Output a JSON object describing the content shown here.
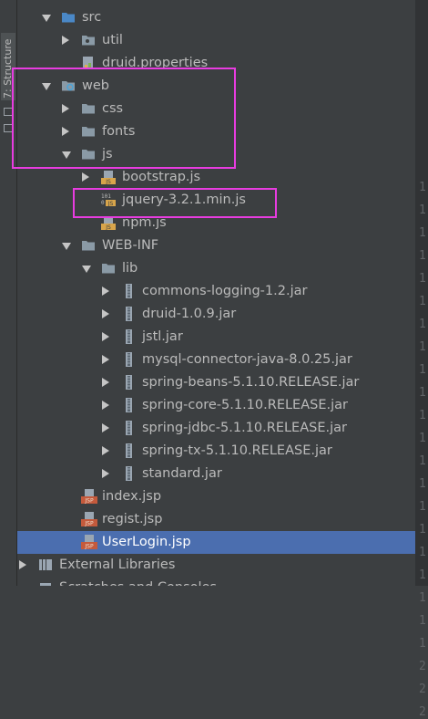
{
  "side_tab": {
    "label": "7: Structure"
  },
  "tree": [
    {
      "label": "src",
      "kind": "folder-src",
      "arrow": "down",
      "indent": 0
    },
    {
      "label": "util",
      "kind": "package",
      "arrow": "right",
      "indent": 1
    },
    {
      "label": "druid.properties",
      "kind": "properties",
      "arrow": "none",
      "indent": 1
    },
    {
      "label": "web",
      "kind": "folder-web",
      "arrow": "down",
      "indent": 0
    },
    {
      "label": "css",
      "kind": "folder",
      "arrow": "right",
      "indent": 1
    },
    {
      "label": "fonts",
      "kind": "folder",
      "arrow": "right",
      "indent": 1
    },
    {
      "label": "js",
      "kind": "folder",
      "arrow": "down",
      "indent": 1
    },
    {
      "label": "bootstrap.js",
      "kind": "js",
      "arrow": "right",
      "indent": 2
    },
    {
      "label": "jquery-3.2.1.min.js",
      "kind": "minjs",
      "arrow": "none",
      "indent": 2
    },
    {
      "label": "npm.js",
      "kind": "js",
      "arrow": "none",
      "indent": 2
    },
    {
      "label": "WEB-INF",
      "kind": "folder",
      "arrow": "down",
      "indent": 1
    },
    {
      "label": "lib",
      "kind": "folder",
      "arrow": "down",
      "indent": 2
    },
    {
      "label": "commons-logging-1.2.jar",
      "kind": "jar",
      "arrow": "right",
      "indent": 3
    },
    {
      "label": "druid-1.0.9.jar",
      "kind": "jar",
      "arrow": "right",
      "indent": 3
    },
    {
      "label": "jstl.jar",
      "kind": "jar",
      "arrow": "right",
      "indent": 3
    },
    {
      "label": "mysql-connector-java-8.0.25.jar",
      "kind": "jar",
      "arrow": "right",
      "indent": 3
    },
    {
      "label": "spring-beans-5.1.10.RELEASE.jar",
      "kind": "jar",
      "arrow": "right",
      "indent": 3
    },
    {
      "label": "spring-core-5.1.10.RELEASE.jar",
      "kind": "jar",
      "arrow": "right",
      "indent": 3
    },
    {
      "label": "spring-jdbc-5.1.10.RELEASE.jar",
      "kind": "jar",
      "arrow": "right",
      "indent": 3
    },
    {
      "label": "spring-tx-5.1.10.RELEASE.jar",
      "kind": "jar",
      "arrow": "right",
      "indent": 3
    },
    {
      "label": "standard.jar",
      "kind": "jar",
      "arrow": "right",
      "indent": 3
    },
    {
      "label": "index.jsp",
      "kind": "jsp",
      "arrow": "none",
      "indent": 1
    },
    {
      "label": "regist.jsp",
      "kind": "jsp",
      "arrow": "none",
      "indent": 1
    },
    {
      "label": "UserLogin.jsp",
      "kind": "jsp",
      "arrow": "none",
      "indent": 1,
      "selected": true
    },
    {
      "label": "External Libraries",
      "kind": "ext-lib",
      "arrow": "right",
      "indent": -1
    },
    {
      "label": "Scratches and Consoles",
      "kind": "scratches",
      "arrow": "none",
      "indent": -1
    }
  ],
  "gutter_numbers": [
    "1",
    "1",
    "1",
    "1",
    "1",
    "1",
    "1",
    "1",
    "1",
    "1",
    "1",
    "1",
    "1",
    "1",
    "1",
    "1",
    "1",
    "1",
    "1",
    "1",
    "1",
    "2",
    "2",
    "2"
  ],
  "colors": {
    "background": "#3c3f41",
    "selection": "#4b6eaf",
    "highlight_box": "#e83ce0",
    "folder": "#8a9aa6",
    "js_badge": "#d8a54b",
    "jsp_badge": "#c45a3c",
    "jar": "#9aa6b2"
  }
}
